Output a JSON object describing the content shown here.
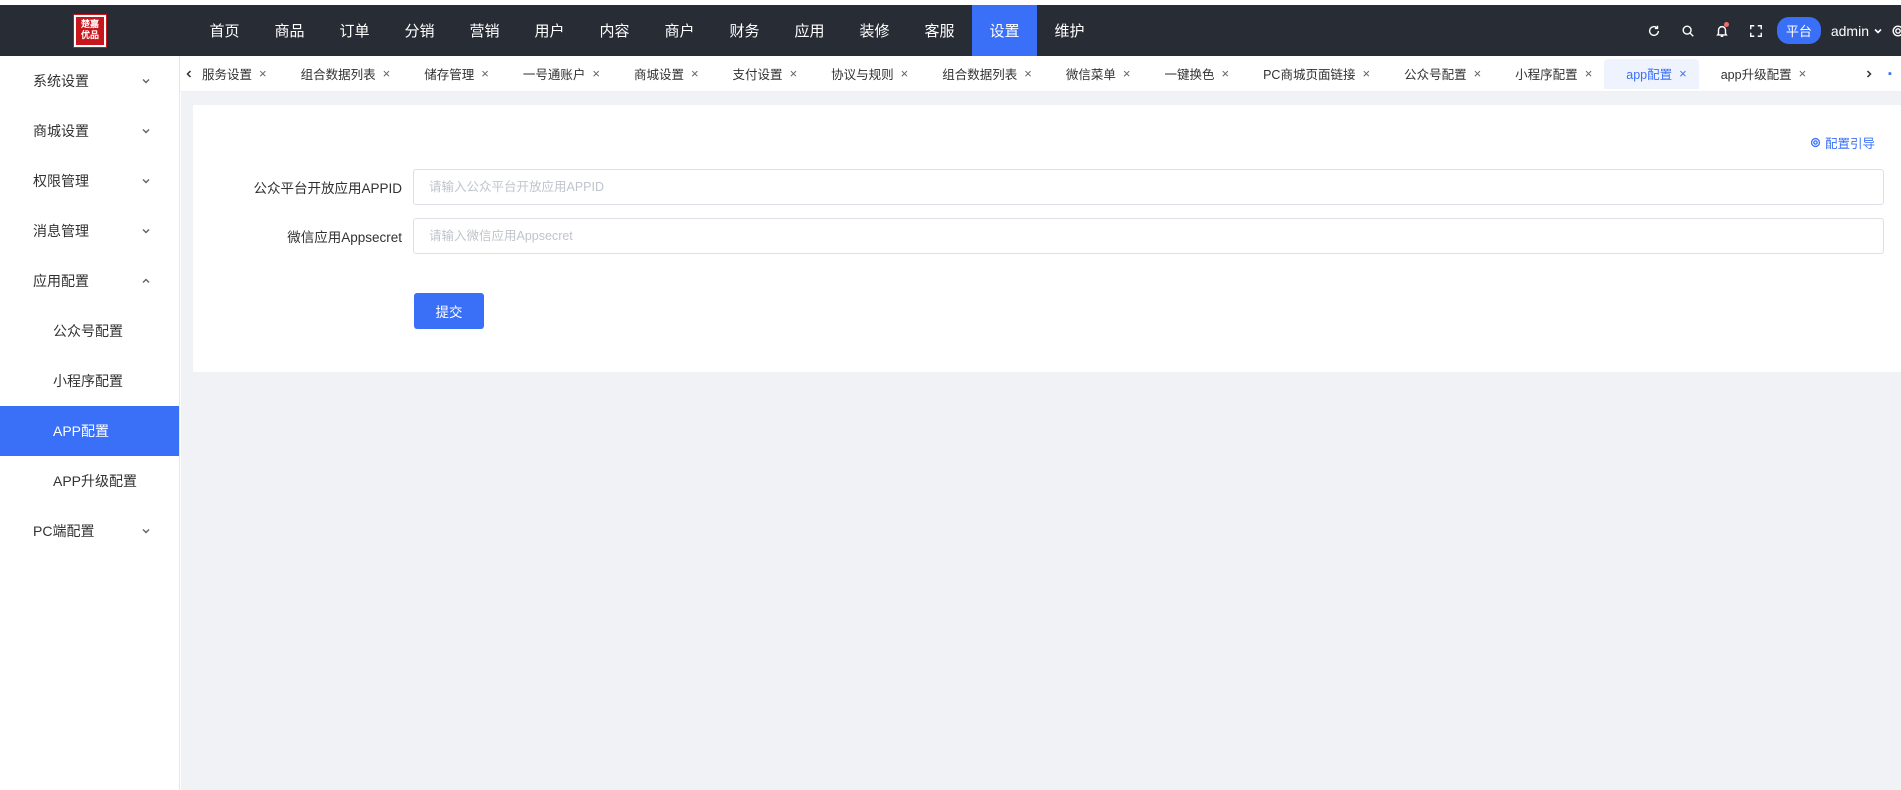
{
  "logo": {
    "line1": "楚嘉",
    "line2": "优品"
  },
  "topnav": [
    {
      "label": "首页",
      "active": false
    },
    {
      "label": "商品",
      "active": false
    },
    {
      "label": "订单",
      "active": false
    },
    {
      "label": "分销",
      "active": false
    },
    {
      "label": "营销",
      "active": false
    },
    {
      "label": "用户",
      "active": false
    },
    {
      "label": "内容",
      "active": false
    },
    {
      "label": "商户",
      "active": false
    },
    {
      "label": "财务",
      "active": false
    },
    {
      "label": "应用",
      "active": false
    },
    {
      "label": "装修",
      "active": false
    },
    {
      "label": "客服",
      "active": false
    },
    {
      "label": "设置",
      "active": true
    },
    {
      "label": "维护",
      "active": false
    }
  ],
  "topright": {
    "platform_label": "平台",
    "user_label": "admin",
    "icons": [
      "refresh-icon",
      "search-icon",
      "bell-icon",
      "fullscreen-icon",
      "chevron-down-icon",
      "settings-icon"
    ]
  },
  "sidebar": {
    "items": [
      {
        "label": "系统设置"
      },
      {
        "label": "商城设置"
      },
      {
        "label": "权限管理"
      },
      {
        "label": "消息管理"
      },
      {
        "label": "应用配置",
        "expanded": true
      },
      {
        "label": "PC端配置"
      }
    ],
    "subitems": [
      {
        "label": "公众号配置"
      },
      {
        "label": "小程序配置"
      },
      {
        "label": "APP配置",
        "active": true
      },
      {
        "label": "APP升级配置"
      }
    ]
  },
  "tabs": [
    {
      "label": "服务设置"
    },
    {
      "label": "组合数据列表"
    },
    {
      "label": "储存管理"
    },
    {
      "label": "一号通账户"
    },
    {
      "label": "商城设置"
    },
    {
      "label": "支付设置"
    },
    {
      "label": "协议与规则"
    },
    {
      "label": "组合数据列表"
    },
    {
      "label": "微信菜单"
    },
    {
      "label": "一键换色"
    },
    {
      "label": "PC商城页面链接"
    },
    {
      "label": "公众号配置"
    },
    {
      "label": "小程序配置"
    },
    {
      "label": "app配置",
      "active": true
    },
    {
      "label": "app升级配置"
    }
  ],
  "tab_close_glyph": "×",
  "form": {
    "guide_label": "配置引导",
    "fields": [
      {
        "label": "公众平台开放应用APPID",
        "placeholder": "请输入公众平台开放应用APPID",
        "value": ""
      },
      {
        "label": "微信应用Appsecret",
        "placeholder": "请输入微信应用Appsecret",
        "value": ""
      }
    ],
    "submit_label": "提交"
  },
  "colors": {
    "accent": "#3a6ff8",
    "topbar_bg": "#282c34",
    "content_bg": "#f0f2f5"
  }
}
